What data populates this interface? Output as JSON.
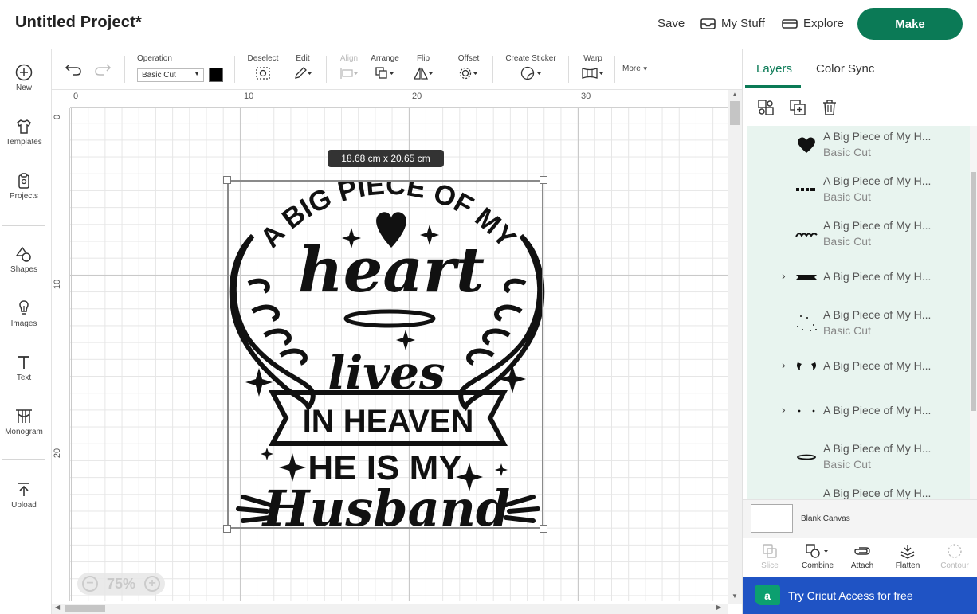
{
  "header": {
    "title": "Untitled Project*",
    "save_label": "Save",
    "my_stuff_label": "My Stuff",
    "explore_label": "Explore",
    "make_label": "Make",
    "make_color": "#0b7a56"
  },
  "sidebar": {
    "items": [
      {
        "label": "New",
        "icon": "plus-circle-icon"
      },
      {
        "label": "Templates",
        "icon": "tshirt-icon"
      },
      {
        "label": "Projects",
        "icon": "clipboard-icon"
      },
      {
        "label": "Shapes",
        "icon": "shapes-icon"
      },
      {
        "label": "Images",
        "icon": "lightbulb-icon"
      },
      {
        "label": "Text",
        "icon": "text-icon"
      },
      {
        "label": "Monogram",
        "icon": "monogram-icon"
      },
      {
        "label": "Upload",
        "icon": "upload-icon"
      }
    ]
  },
  "toolbar": {
    "operation_label": "Operation",
    "operation_value": "Basic Cut",
    "deselect_label": "Deselect",
    "edit_label": "Edit",
    "align_label": "Align",
    "arrange_label": "Arrange",
    "flip_label": "Flip",
    "offset_label": "Offset",
    "create_sticker_label": "Create Sticker",
    "warp_label": "Warp",
    "more_label": "More",
    "color_value": "#000000"
  },
  "canvas": {
    "ruler_top": [
      "0",
      "10",
      "20",
      "30"
    ],
    "ruler_left": [
      "0",
      "10",
      "20"
    ],
    "size_tooltip": "18.68  cm x 20.65  cm",
    "zoom": "75%",
    "design_text": {
      "arc": "A BIG PIECE OF MY",
      "heart": "heart",
      "lives": "lives",
      "banner": "IN HEAVEN",
      "line4": "HE IS MY",
      "husband": "Husband"
    }
  },
  "right_panel": {
    "tabs": [
      "Layers",
      "Color Sync"
    ],
    "active_tab": "Layers",
    "layers": [
      {
        "name": "A Big Piece of My H...",
        "type": "Basic Cut",
        "thumb": "heart",
        "expandable": false
      },
      {
        "name": "A Big Piece of My H...",
        "type": "Basic Cut",
        "thumb": "he-is-my",
        "expandable": false
      },
      {
        "name": "A Big Piece of My H...",
        "type": "Basic Cut",
        "thumb": "husband",
        "expandable": false
      },
      {
        "name": "A Big Piece of My H...",
        "type": "",
        "thumb": "banner",
        "expandable": true
      },
      {
        "name": "A Big Piece of My H...",
        "type": "Basic Cut",
        "thumb": "stars",
        "expandable": false
      },
      {
        "name": "A Big Piece of My H...",
        "type": "",
        "thumb": "wings",
        "expandable": true
      },
      {
        "name": "A Big Piece of My H...",
        "type": "",
        "thumb": "dots",
        "expandable": true
      },
      {
        "name": "A Big Piece of My H...",
        "type": "Basic Cut",
        "thumb": "halo",
        "expandable": false
      },
      {
        "name": "A Big Piece of My H...",
        "type": "",
        "thumb": "partial",
        "expandable": false
      }
    ],
    "blank_canvas_label": "Blank Canvas",
    "actions": [
      {
        "label": "Slice",
        "disabled": true
      },
      {
        "label": "Combine",
        "disabled": false
      },
      {
        "label": "Attach",
        "disabled": false
      },
      {
        "label": "Flatten",
        "disabled": false
      },
      {
        "label": "Contour",
        "disabled": true
      }
    ],
    "access_label": "Try Cricut Access for free",
    "access_color": "#1f53c4"
  }
}
